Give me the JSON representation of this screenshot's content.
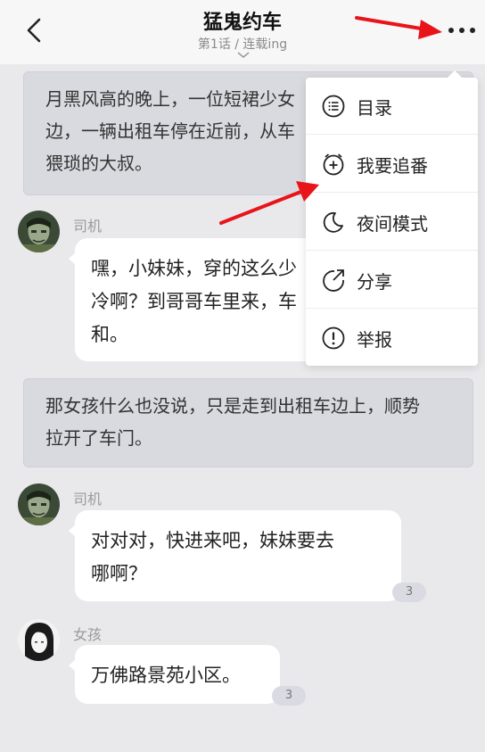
{
  "header": {
    "title": "猛鬼约车",
    "subtitle": "第1话 / 连载ing",
    "back_icon": "chevron-left-icon",
    "more_icon": "more-dots-icon"
  },
  "story": {
    "narration_1": {
      "line1": "月黑风高的晚上，一位短裙少女",
      "line2": "边，一辆出租车停在近前，从车",
      "line3": "猥琐的大叔。"
    },
    "msg_1": {
      "speaker": "司机",
      "line1": "嘿，小妹妹，穿的这么少",
      "line2": "冷啊？到哥哥车里来，车",
      "line3": "和。"
    },
    "narration_2": {
      "line1": "那女孩什么也没说，只是走到出租车边上，顺势",
      "line2": "拉开了车门。"
    },
    "msg_2": {
      "speaker": "司机",
      "line1": "对对对，快进来吧，妹妹要去",
      "line2": "哪啊？",
      "count": "3"
    },
    "msg_3": {
      "speaker": "女孩",
      "line1": "万佛路景苑小区。",
      "count": "3"
    }
  },
  "menu": {
    "items": [
      {
        "label": "目录",
        "icon": "list-icon"
      },
      {
        "label": "我要追番",
        "icon": "alarm-add-icon"
      },
      {
        "label": "夜间模式",
        "icon": "moon-icon"
      },
      {
        "label": "分享",
        "icon": "share-icon"
      },
      {
        "label": "举报",
        "icon": "report-icon"
      }
    ]
  },
  "colors": {
    "background": "#e9e9ec",
    "narration_bg": "#d9dae0",
    "annotation_arrow": "#e8141a"
  }
}
